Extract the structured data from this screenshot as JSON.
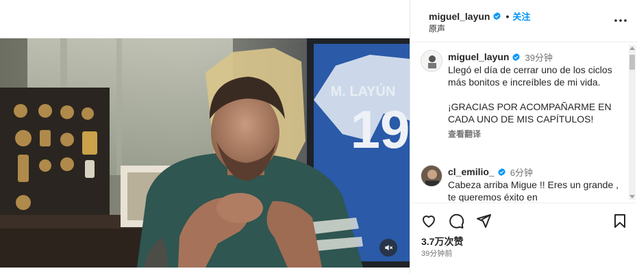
{
  "post": {
    "author": "miguel_layun",
    "follow_label": "关注",
    "audio_label": "原声",
    "dot": "•",
    "likes": "3.7万次赞",
    "time_ago": "39分钟前"
  },
  "jersey": {
    "name": "M. LAYÚN",
    "number": "19"
  },
  "comments": [
    {
      "user": "miguel_layun",
      "verified": true,
      "time": "39分钟",
      "text": "Llegó el día de cerrar uno de los ciclos más bonitos e increíbles de mi vida.\n\n¡GRACIAS POR ACOMPAÑARME EN CADA UNO DE MIS CAPÍTULOS!",
      "translate_label": "查看翻译"
    },
    {
      "user": "cl_emilio_",
      "verified": true,
      "time": "6分钟",
      "text": "Cabeza arriba Migue !! Eres un grande , te queremos éxito en"
    }
  ],
  "icons": {
    "verified": "verified-badge-icon",
    "more": "more-options-icon",
    "like": "heart-icon",
    "comment": "comment-icon",
    "share": "share-icon",
    "save": "bookmark-icon",
    "mute": "muted-speaker-icon"
  },
  "colors": {
    "accent": "#0095f6",
    "verified": "#0095f6",
    "muted_text": "#737373"
  }
}
